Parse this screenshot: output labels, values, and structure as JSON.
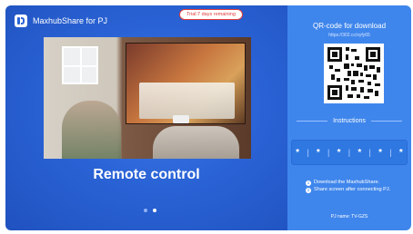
{
  "app": {
    "name": "MaxhubShare for PJ"
  },
  "trial_badge": "Trial:7 days remaining",
  "carousel": {
    "caption": "Remote control",
    "page_index": 1,
    "page_count": 2
  },
  "download": {
    "title": "QR-code for download",
    "url": "https://302.cc/xyfy65",
    "instructions_title": "Instructions",
    "pin": [
      "*",
      "*",
      "*",
      "*",
      "*",
      "*"
    ],
    "steps": [
      "Download the MaxhubShare.",
      "Share screen after connecting PJ."
    ]
  },
  "pj_name": "PJ name: TV-GZS",
  "colors": {
    "accent": "#3f86ec",
    "left_bg": "#2a63d6",
    "trial": "#e23b3b"
  }
}
